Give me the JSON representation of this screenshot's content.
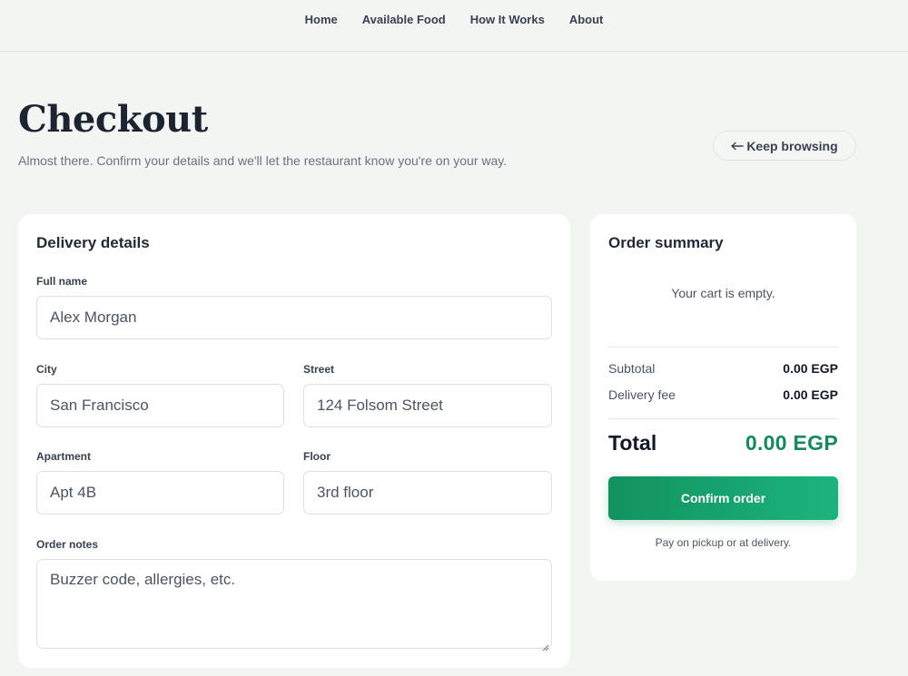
{
  "nav": {
    "items": [
      "Home",
      "Available Food",
      "How It Works",
      "About"
    ]
  },
  "header": {
    "title": "Checkout",
    "subtitle": "Almost there. Confirm your details and we'll let the restaurant know you're on your way.",
    "keep_browsing": "Keep browsing",
    "keep_browsing_icon": "arrow-left-icon"
  },
  "delivery": {
    "title": "Delivery details",
    "full_name": {
      "label": "Full name",
      "placeholder": "Alex Morgan"
    },
    "city": {
      "label": "City",
      "placeholder": "San Francisco"
    },
    "street": {
      "label": "Street",
      "placeholder": "124 Folsom Street"
    },
    "apartment": {
      "label": "Apartment",
      "placeholder": "Apt 4B"
    },
    "floor": {
      "label": "Floor",
      "placeholder": "3rd floor"
    },
    "notes": {
      "label": "Order notes",
      "placeholder": "Buzzer code, allergies, etc."
    }
  },
  "summary": {
    "title": "Order summary",
    "empty": "Your cart is empty.",
    "subtotal_label": "Subtotal",
    "subtotal_value": "0.00 EGP",
    "delivery_label": "Delivery fee",
    "delivery_value": "0.00 EGP",
    "total_label": "Total",
    "total_value": "0.00 EGP",
    "confirm": "Confirm order",
    "payment_note": "Pay on pickup or at delivery."
  },
  "colors": {
    "accent": "#148a5b",
    "button_start": "#12925f",
    "button_end": "#1cb47c",
    "background": "#f3f5f3"
  }
}
